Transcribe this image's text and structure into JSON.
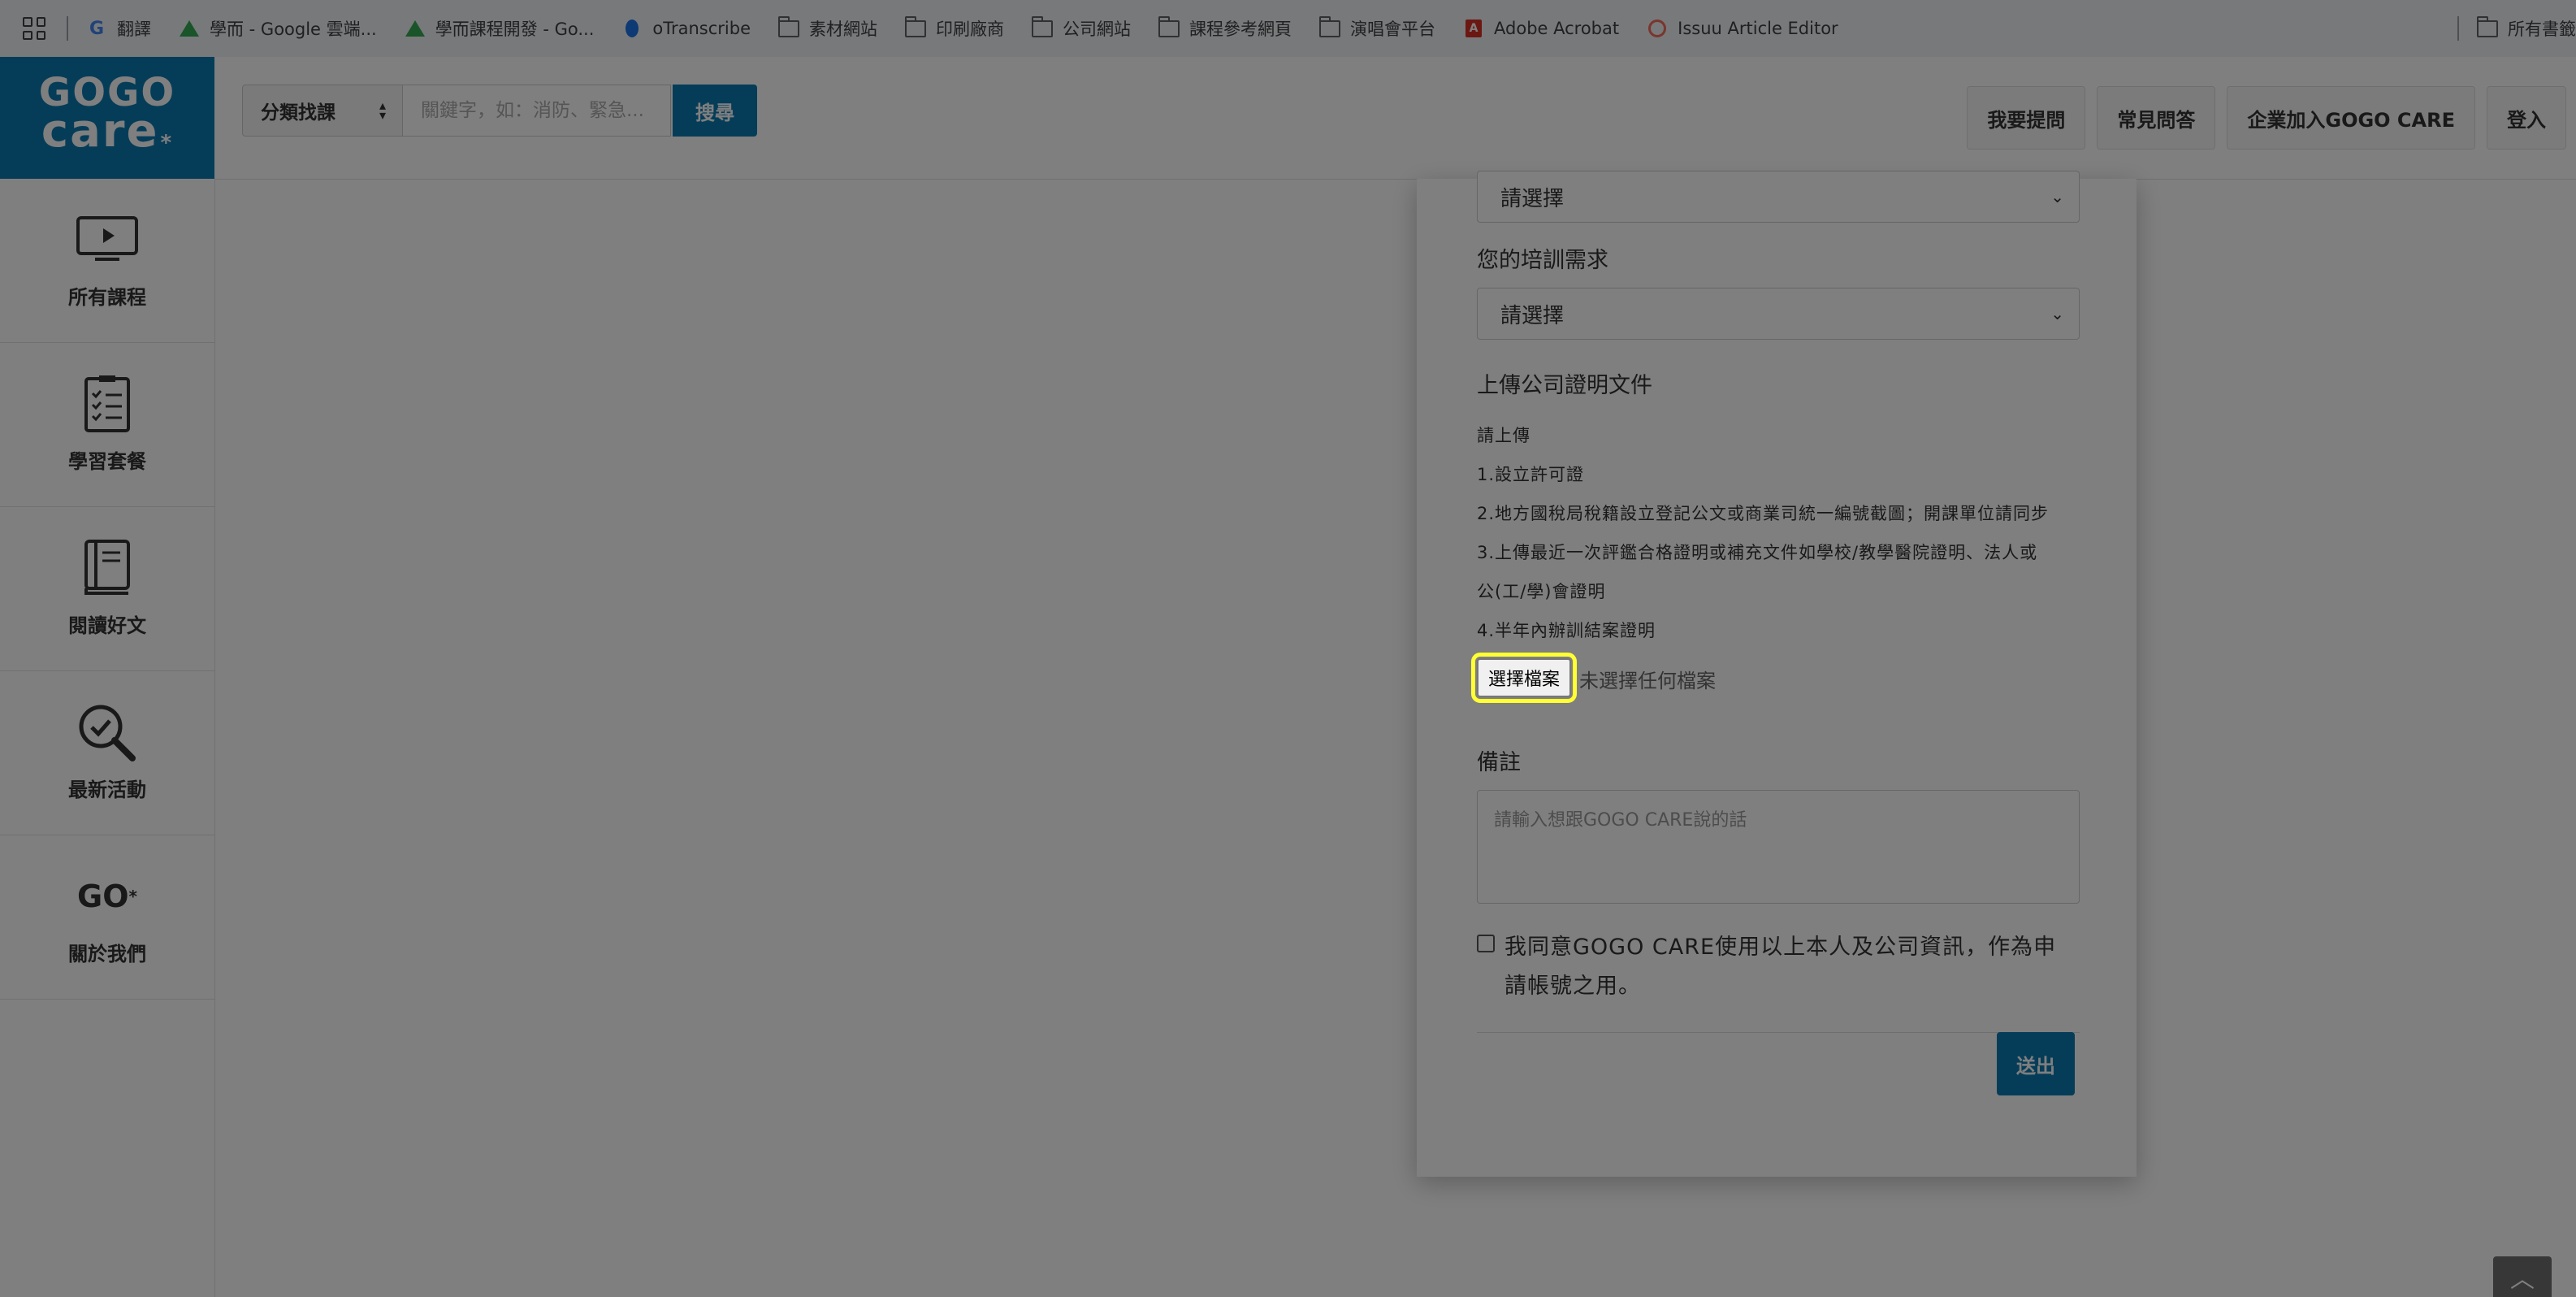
{
  "bookmarks": {
    "items": [
      {
        "icon": "google-icon",
        "label": "翻譯"
      },
      {
        "icon": "google-drive-icon",
        "label": "學而 - Google 雲端..."
      },
      {
        "icon": "google-drive-icon",
        "label": "學而課程開發 - Go..."
      },
      {
        "icon": "otranscribe-icon",
        "label": "oTranscribe"
      },
      {
        "icon": "folder-icon",
        "label": "素材網站"
      },
      {
        "icon": "folder-icon",
        "label": "印刷廠商"
      },
      {
        "icon": "folder-icon",
        "label": "公司網站"
      },
      {
        "icon": "folder-icon",
        "label": "課程參考網頁"
      },
      {
        "icon": "folder-icon",
        "label": "演唱會平台"
      },
      {
        "icon": "adobe-acrobat-icon",
        "label": "Adobe Acrobat"
      },
      {
        "icon": "issuu-icon",
        "label": "Issuu Article Editor"
      }
    ],
    "all_bookmarks": "所有書籤"
  },
  "logo": {
    "line1": "GOGO",
    "line2": "care",
    "mark": "*"
  },
  "search": {
    "category_label": "分類找課",
    "placeholder": "關鍵字，如：消防、緊急...",
    "button_label": "搜尋"
  },
  "nav": {
    "ask": "我要提問",
    "faq": "常見問答",
    "join": "企業加入GOGO CARE",
    "login": "登入"
  },
  "sidebar": {
    "items": [
      {
        "icon": "monitor-play-icon",
        "label": "所有課程"
      },
      {
        "icon": "checklist-icon",
        "label": "學習套餐"
      },
      {
        "icon": "book-icon",
        "label": "閱讀好文"
      },
      {
        "icon": "magnifier-check-icon",
        "label": "最新活動"
      },
      {
        "icon": "go-logo-icon",
        "label": "關於我們",
        "icon_text": "GO",
        "icon_mark": "*"
      }
    ]
  },
  "form": {
    "select_top_value": "請選擇",
    "training_label": "您的培訓需求",
    "training_value": "請選擇",
    "upload_label": "上傳公司證明文件",
    "upload_notes": [
      "請上傳",
      "1.設立許可證",
      "2.地方國稅局稅籍設立登記公文或商業司統一編號截圖；開課單位請同步",
      "3.上傳最近一次評鑑合格證明或補充文件如學校/教學醫院證明、法人或",
      "公(工/學)會證明",
      "4.半年內辦訓結案證明"
    ],
    "file_button": "選擇檔案",
    "file_status": "未選擇任何檔案",
    "remark_label": "備註",
    "remark_placeholder": "請輸入想跟GOGO CARE說的話",
    "agree_text": "我同意GOGO CARE使用以上本人及公司資訊，作為申請帳號之用。",
    "submit": "送出"
  },
  "colors": {
    "brand": "#0a7ab3",
    "highlight": "#ffff33"
  }
}
